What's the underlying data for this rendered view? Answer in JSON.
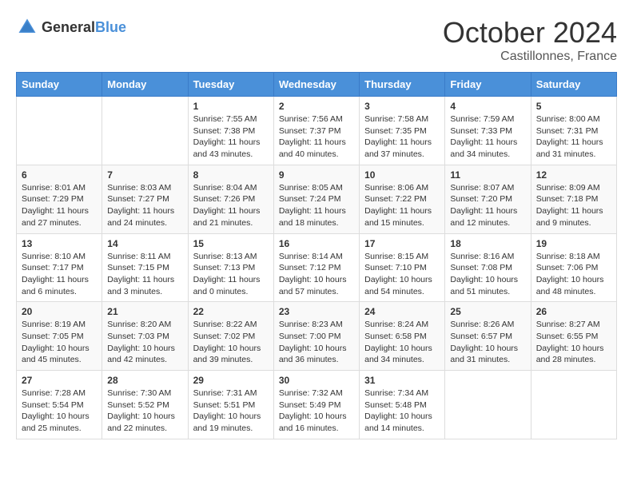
{
  "header": {
    "logo_general": "General",
    "logo_blue": "Blue",
    "month": "October 2024",
    "location": "Castillonnes, France"
  },
  "days_of_week": [
    "Sunday",
    "Monday",
    "Tuesday",
    "Wednesday",
    "Thursday",
    "Friday",
    "Saturday"
  ],
  "weeks": [
    [
      {
        "day": "",
        "info": ""
      },
      {
        "day": "",
        "info": ""
      },
      {
        "day": "1",
        "sunrise": "Sunrise: 7:55 AM",
        "sunset": "Sunset: 7:38 PM",
        "daylight": "Daylight: 11 hours and 43 minutes."
      },
      {
        "day": "2",
        "sunrise": "Sunrise: 7:56 AM",
        "sunset": "Sunset: 7:37 PM",
        "daylight": "Daylight: 11 hours and 40 minutes."
      },
      {
        "day": "3",
        "sunrise": "Sunrise: 7:58 AM",
        "sunset": "Sunset: 7:35 PM",
        "daylight": "Daylight: 11 hours and 37 minutes."
      },
      {
        "day": "4",
        "sunrise": "Sunrise: 7:59 AM",
        "sunset": "Sunset: 7:33 PM",
        "daylight": "Daylight: 11 hours and 34 minutes."
      },
      {
        "day": "5",
        "sunrise": "Sunrise: 8:00 AM",
        "sunset": "Sunset: 7:31 PM",
        "daylight": "Daylight: 11 hours and 31 minutes."
      }
    ],
    [
      {
        "day": "6",
        "sunrise": "Sunrise: 8:01 AM",
        "sunset": "Sunset: 7:29 PM",
        "daylight": "Daylight: 11 hours and 27 minutes."
      },
      {
        "day": "7",
        "sunrise": "Sunrise: 8:03 AM",
        "sunset": "Sunset: 7:27 PM",
        "daylight": "Daylight: 11 hours and 24 minutes."
      },
      {
        "day": "8",
        "sunrise": "Sunrise: 8:04 AM",
        "sunset": "Sunset: 7:26 PM",
        "daylight": "Daylight: 11 hours and 21 minutes."
      },
      {
        "day": "9",
        "sunrise": "Sunrise: 8:05 AM",
        "sunset": "Sunset: 7:24 PM",
        "daylight": "Daylight: 11 hours and 18 minutes."
      },
      {
        "day": "10",
        "sunrise": "Sunrise: 8:06 AM",
        "sunset": "Sunset: 7:22 PM",
        "daylight": "Daylight: 11 hours and 15 minutes."
      },
      {
        "day": "11",
        "sunrise": "Sunrise: 8:07 AM",
        "sunset": "Sunset: 7:20 PM",
        "daylight": "Daylight: 11 hours and 12 minutes."
      },
      {
        "day": "12",
        "sunrise": "Sunrise: 8:09 AM",
        "sunset": "Sunset: 7:18 PM",
        "daylight": "Daylight: 11 hours and 9 minutes."
      }
    ],
    [
      {
        "day": "13",
        "sunrise": "Sunrise: 8:10 AM",
        "sunset": "Sunset: 7:17 PM",
        "daylight": "Daylight: 11 hours and 6 minutes."
      },
      {
        "day": "14",
        "sunrise": "Sunrise: 8:11 AM",
        "sunset": "Sunset: 7:15 PM",
        "daylight": "Daylight: 11 hours and 3 minutes."
      },
      {
        "day": "15",
        "sunrise": "Sunrise: 8:13 AM",
        "sunset": "Sunset: 7:13 PM",
        "daylight": "Daylight: 11 hours and 0 minutes."
      },
      {
        "day": "16",
        "sunrise": "Sunrise: 8:14 AM",
        "sunset": "Sunset: 7:12 PM",
        "daylight": "Daylight: 10 hours and 57 minutes."
      },
      {
        "day": "17",
        "sunrise": "Sunrise: 8:15 AM",
        "sunset": "Sunset: 7:10 PM",
        "daylight": "Daylight: 10 hours and 54 minutes."
      },
      {
        "day": "18",
        "sunrise": "Sunrise: 8:16 AM",
        "sunset": "Sunset: 7:08 PM",
        "daylight": "Daylight: 10 hours and 51 minutes."
      },
      {
        "day": "19",
        "sunrise": "Sunrise: 8:18 AM",
        "sunset": "Sunset: 7:06 PM",
        "daylight": "Daylight: 10 hours and 48 minutes."
      }
    ],
    [
      {
        "day": "20",
        "sunrise": "Sunrise: 8:19 AM",
        "sunset": "Sunset: 7:05 PM",
        "daylight": "Daylight: 10 hours and 45 minutes."
      },
      {
        "day": "21",
        "sunrise": "Sunrise: 8:20 AM",
        "sunset": "Sunset: 7:03 PM",
        "daylight": "Daylight: 10 hours and 42 minutes."
      },
      {
        "day": "22",
        "sunrise": "Sunrise: 8:22 AM",
        "sunset": "Sunset: 7:02 PM",
        "daylight": "Daylight: 10 hours and 39 minutes."
      },
      {
        "day": "23",
        "sunrise": "Sunrise: 8:23 AM",
        "sunset": "Sunset: 7:00 PM",
        "daylight": "Daylight: 10 hours and 36 minutes."
      },
      {
        "day": "24",
        "sunrise": "Sunrise: 8:24 AM",
        "sunset": "Sunset: 6:58 PM",
        "daylight": "Daylight: 10 hours and 34 minutes."
      },
      {
        "day": "25",
        "sunrise": "Sunrise: 8:26 AM",
        "sunset": "Sunset: 6:57 PM",
        "daylight": "Daylight: 10 hours and 31 minutes."
      },
      {
        "day": "26",
        "sunrise": "Sunrise: 8:27 AM",
        "sunset": "Sunset: 6:55 PM",
        "daylight": "Daylight: 10 hours and 28 minutes."
      }
    ],
    [
      {
        "day": "27",
        "sunrise": "Sunrise: 7:28 AM",
        "sunset": "Sunset: 5:54 PM",
        "daylight": "Daylight: 10 hours and 25 minutes."
      },
      {
        "day": "28",
        "sunrise": "Sunrise: 7:30 AM",
        "sunset": "Sunset: 5:52 PM",
        "daylight": "Daylight: 10 hours and 22 minutes."
      },
      {
        "day": "29",
        "sunrise": "Sunrise: 7:31 AM",
        "sunset": "Sunset: 5:51 PM",
        "daylight": "Daylight: 10 hours and 19 minutes."
      },
      {
        "day": "30",
        "sunrise": "Sunrise: 7:32 AM",
        "sunset": "Sunset: 5:49 PM",
        "daylight": "Daylight: 10 hours and 16 minutes."
      },
      {
        "day": "31",
        "sunrise": "Sunrise: 7:34 AM",
        "sunset": "Sunset: 5:48 PM",
        "daylight": "Daylight: 10 hours and 14 minutes."
      },
      {
        "day": "",
        "info": ""
      },
      {
        "day": "",
        "info": ""
      }
    ]
  ]
}
